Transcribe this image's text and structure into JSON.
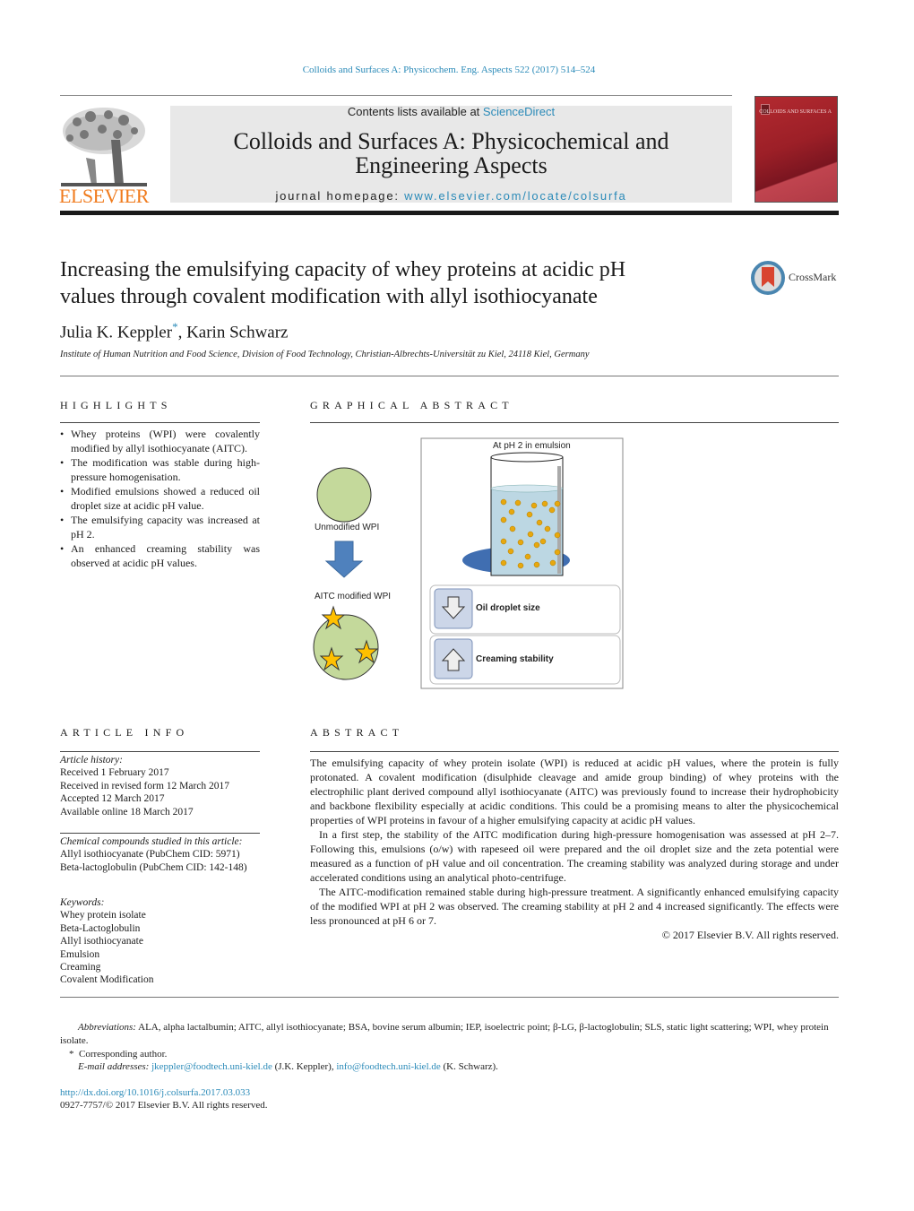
{
  "header": {
    "citation": "Colloids and Surfaces A: Physicochem. Eng. Aspects 522 (2017) 514–524",
    "contents_prefix": "Contents lists available at ",
    "contents_link": "ScienceDirect",
    "journal_title_line1": "Colloids and Surfaces A: Physicochemical and",
    "journal_title_line2": "Engineering Aspects",
    "homepage_prefix": "journal homepage: ",
    "homepage_link": "www.elsevier.com/locate/colsurfa",
    "publisher_logo_text": "ELSEVIER",
    "cover_text": "COLLOIDS AND SURFACES A",
    "crossmark_label": "CrossMark",
    "colors": {
      "link": "#2a8ab8",
      "elsevier_orange": "#f07b1d",
      "cover_red": "#a8232b"
    }
  },
  "article": {
    "title_line1": "Increasing the emulsifying capacity of whey proteins at acidic pH",
    "title_line2": "values through covalent modification with allyl isothiocyanate",
    "author1": "Julia K. Keppler",
    "author1_mark": "*",
    "author_sep": ", ",
    "author2": "Karin Schwarz",
    "affiliation": "Institute of Human Nutrition and Food Science, Division of Food Technology, Christian-Albrechts-Universität zu Kiel, 24118 Kiel, Germany"
  },
  "highlights": {
    "heading": "HIGHLIGHTS",
    "items": [
      "Whey proteins (WPI) were covalently modified by allyl isothiocyanate (AITC).",
      "The modification was stable during high-pressure homogenisation.",
      "Modified emulsions showed a reduced oil droplet size at acidic pH value.",
      "The emulsifying capacity was increased at pH 2.",
      "An enhanced creaming stability was observed at acidic pH values."
    ]
  },
  "graphical_abstract": {
    "heading": "GRAPHICAL ABSTRACT",
    "unmodified_label": "Unmodified WPI",
    "modified_label": "AITC modified WPI",
    "beaker_label": "At pH 2 in emulsion",
    "box1_label": "Oil droplet size",
    "box1_arrow": "down",
    "box2_label": "Creaming stability",
    "box2_arrow": "up"
  },
  "article_info": {
    "heading": "ARTICLE INFO",
    "history_label": "Article history:",
    "history": [
      "Received 1 February 2017",
      "Received in revised form 12 March 2017",
      "Accepted 12 March 2017",
      "Available online 18 March 2017"
    ],
    "compounds_label": "Chemical compounds studied in this article:",
    "compounds": [
      "Allyl isothiocyanate (PubChem CID: 5971)",
      "Beta-lactoglobulin (PubChem CID: 142-148)"
    ],
    "keywords_label": "Keywords:",
    "keywords": [
      "Whey protein isolate",
      "Beta-Lactoglobulin",
      "Allyl isothiocyanate",
      "Emulsion",
      "Creaming",
      "Covalent Modification"
    ]
  },
  "abstract": {
    "heading": "ABSTRACT",
    "paragraphs": [
      "The emulsifying capacity of whey protein isolate (WPI) is reduced at acidic pH values, where the protein is fully protonated. A covalent modification (disulphide cleavage and amide group binding) of whey proteins with the electrophilic plant derived compound allyl isothiocyanate (AITC) was previously found to increase their hydrophobicity and backbone flexibility especially at acidic conditions. This could be a promising means to alter the physicochemical properties of WPI proteins in favour of a higher emulsifying capacity at acidic pH values.",
      "In a first step, the stability of the AITC modification during high-pressure homogenisation was assessed at pH 2–7. Following this, emulsions (o/w) with rapeseed oil were prepared and the oil droplet size and the zeta potential were measured as a function of pH value and oil concentration. The creaming stability was analyzed during storage and under accelerated conditions using an analytical photo-centrifuge.",
      "The AITC-modification remained stable during high-pressure treatment. A significantly enhanced emulsifying capacity of the modified WPI at pH 2 was observed. The creaming stability at pH 2 and 4 increased significantly. The effects were less pronounced at pH 6 or 7."
    ],
    "copyright": "© 2017 Elsevier B.V. All rights reserved."
  },
  "footnotes": {
    "abbreviations_label": "Abbreviations:",
    "abbreviations_text": "ALA, alpha lactalbumin; AITC, allyl isothiocyanate; BSA, bovine serum albumin; IEP, isoelectric point; β-LG, β-lactoglobulin; SLS, static light scattering; WPI, whey protein isolate.",
    "corresponding_mark": "*",
    "corresponding_text": "Corresponding author.",
    "email_label": "E-mail addresses:",
    "email1": "jkeppler@foodtech.uni-kiel.de",
    "email1_owner": " (J.K. Keppler), ",
    "email2": "info@foodtech.uni-kiel.de",
    "email2_owner": " (K. Schwarz).",
    "doi": "http://dx.doi.org/10.1016/j.colsurfa.2017.03.033",
    "issn": "0927-7757/© 2017 Elsevier B.V. All rights reserved."
  }
}
